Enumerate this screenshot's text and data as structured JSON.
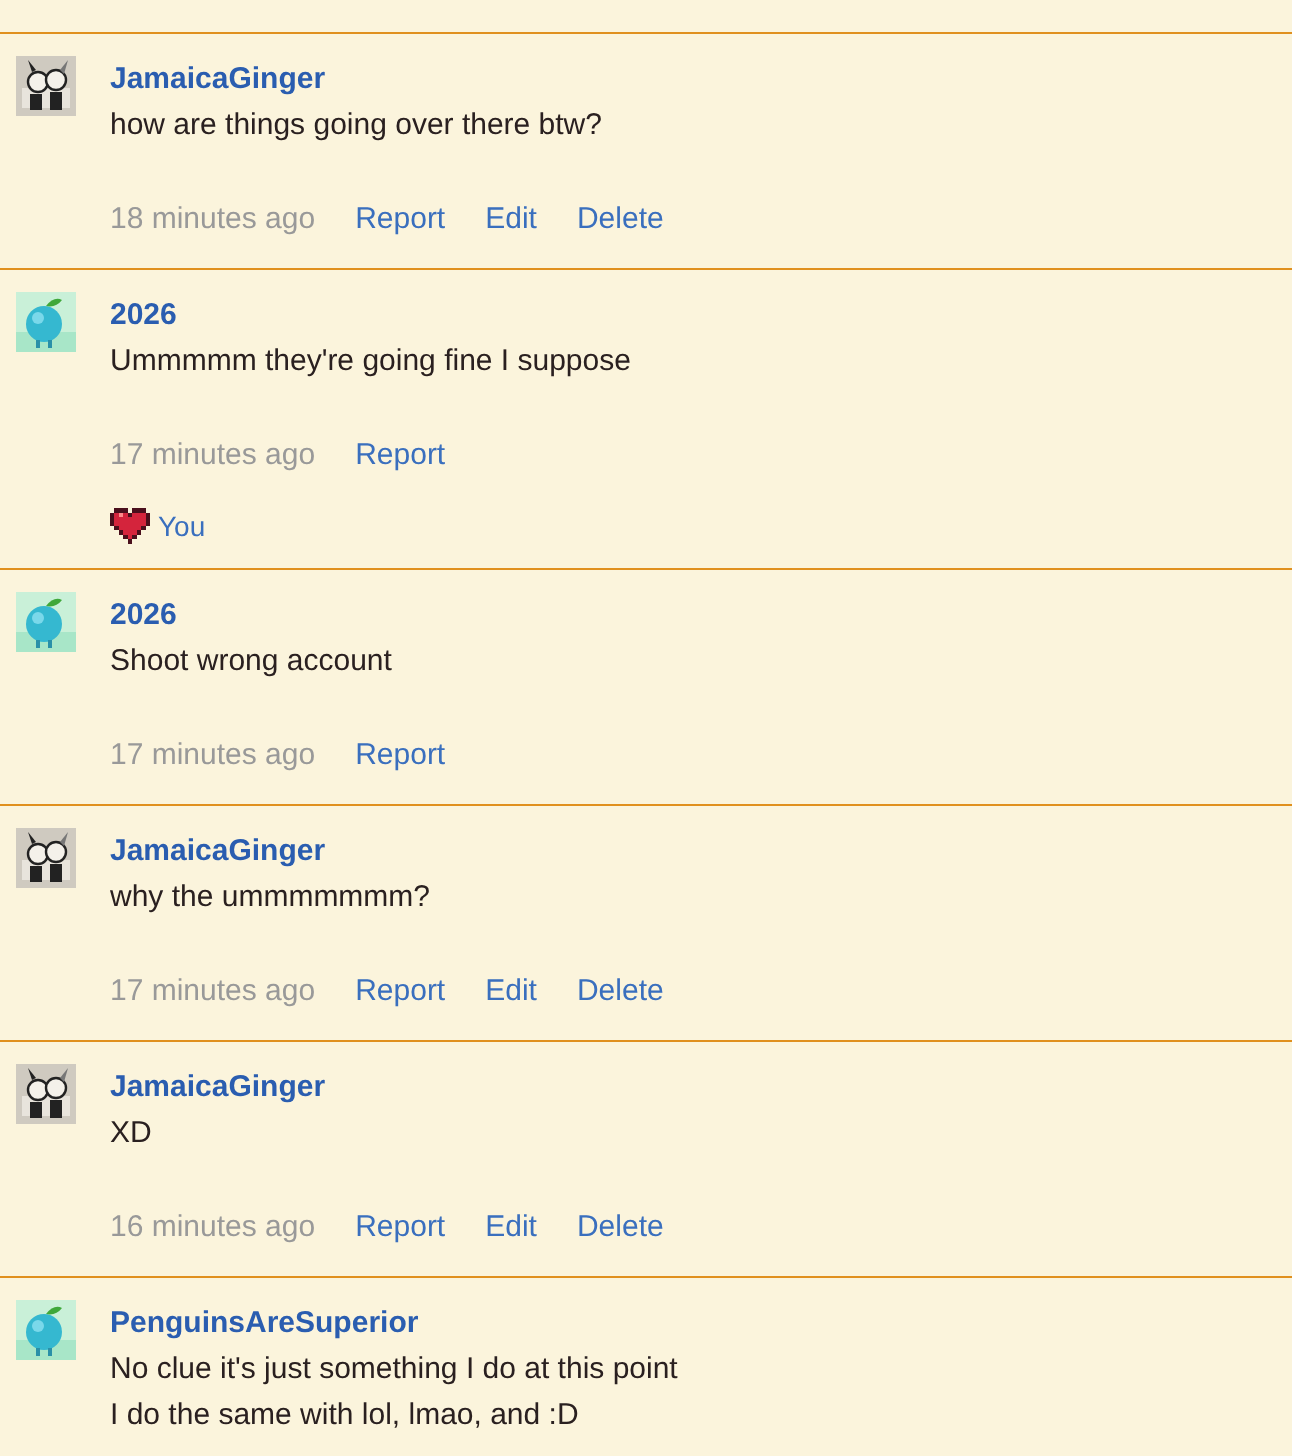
{
  "comments": [
    {
      "avatar": {
        "kind": "sketch"
      },
      "author": "JamaicaGinger",
      "text": [
        "how are things going over there btw?"
      ],
      "time": "18 minutes ago",
      "actions": [
        "Report",
        "Edit",
        "Delete"
      ]
    },
    {
      "avatar": {
        "kind": "apple"
      },
      "author": "2026",
      "text": [
        "Ummmmm they're going fine I suppose"
      ],
      "time": "17 minutes ago",
      "actions": [
        "Report"
      ],
      "likes": [
        "You"
      ]
    },
    {
      "avatar": {
        "kind": "apple"
      },
      "author": "2026",
      "text": [
        "Shoot wrong account"
      ],
      "time": "17 minutes ago",
      "actions": [
        "Report"
      ]
    },
    {
      "avatar": {
        "kind": "sketch"
      },
      "author": "JamaicaGinger",
      "text": [
        "why the ummmmmmm?"
      ],
      "time": "17 minutes ago",
      "actions": [
        "Report",
        "Edit",
        "Delete"
      ]
    },
    {
      "avatar": {
        "kind": "sketch"
      },
      "author": "JamaicaGinger",
      "text": [
        "XD"
      ],
      "time": "16 minutes ago",
      "actions": [
        "Report",
        "Edit",
        "Delete"
      ]
    },
    {
      "avatar": {
        "kind": "apple"
      },
      "author": "PenguinsAreSuperior",
      "text": [
        "No clue it's just something I do at this point",
        "I do the same with lol, lmao, and :D"
      ]
    }
  ]
}
